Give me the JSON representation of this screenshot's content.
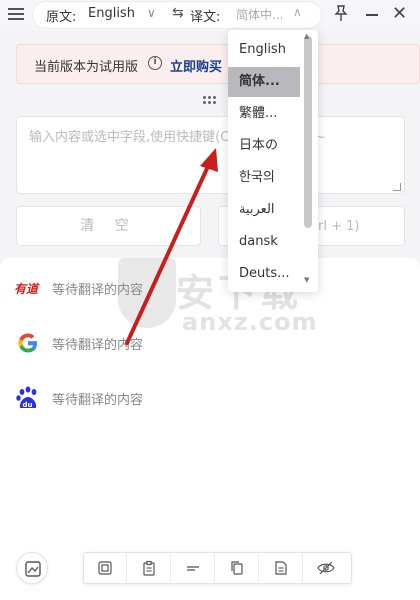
{
  "topbar": {
    "source_label": "原文:",
    "source_value": "English",
    "target_label": "译文:",
    "target_value": "简体中..."
  },
  "banner": {
    "text": "当前版本为试用版",
    "buy_link": "立即购买"
  },
  "input": {
    "placeholder": "输入内容或选中字段,使用快捷键(Ctrl + 1)翻译吧~"
  },
  "buttons": {
    "clear": "清 空",
    "translate_hint": "rl + 1)"
  },
  "results": {
    "engines": [
      {
        "name": "youdao-logo",
        "label": "有道",
        "text": "等待翻译的内容"
      },
      {
        "name": "google-logo",
        "label": "G",
        "text": "等待翻译的内容"
      },
      {
        "name": "baidu-logo",
        "label": "du",
        "text": "等待翻译的内容"
      }
    ]
  },
  "dropdown": {
    "options": [
      "English",
      "简体...",
      "繁體...",
      "日本の",
      "한국의",
      "العربية",
      "dansk",
      "Deuts..."
    ],
    "selected_index": 1
  },
  "watermark": {
    "cn": "安下载",
    "en": "anxz.com"
  },
  "toolbar": {
    "tools": [
      "copy-icon",
      "paste-icon",
      "format-icon",
      "duplicate-icon",
      "document-icon",
      "hide-icon"
    ]
  },
  "colors": {
    "accent": "#1a3e8a",
    "banner_bg": "#fbeeee",
    "selected_bg": "#b9b9bd",
    "annotation": "#d0201f"
  }
}
